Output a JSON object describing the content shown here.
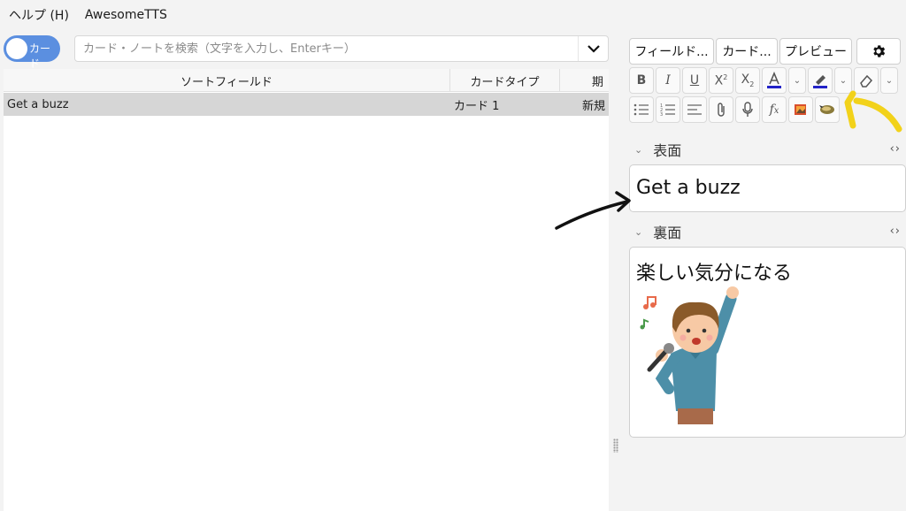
{
  "menu": {
    "items": [
      "ヘルプ (H)",
      "AwesomeTTS"
    ]
  },
  "toggle": {
    "label": "カード"
  },
  "search": {
    "placeholder": "カード・ノートを検索（文字を入力し、Enterキー）",
    "value": ""
  },
  "table": {
    "columns": [
      "ソートフィールド",
      "カードタイプ",
      "期"
    ],
    "rows": [
      {
        "sort_field": "Get a buzz",
        "card_type": "カード 1",
        "due": "新規"
      }
    ]
  },
  "editor": {
    "tabs": {
      "fields": "フィールド...",
      "cards": "カード...",
      "preview": "プレビュー"
    },
    "fields": [
      {
        "name": "表面",
        "value": "Get a buzz"
      },
      {
        "name": "裏面",
        "value": "楽しい気分になる"
      }
    ]
  },
  "colors": {
    "accent": "#5b8fe0",
    "text_color_bar": "#2323c8",
    "highlight_bar": "#2323c8",
    "annotation_yellow": "#f2d21a",
    "annotation_black": "#111111"
  }
}
